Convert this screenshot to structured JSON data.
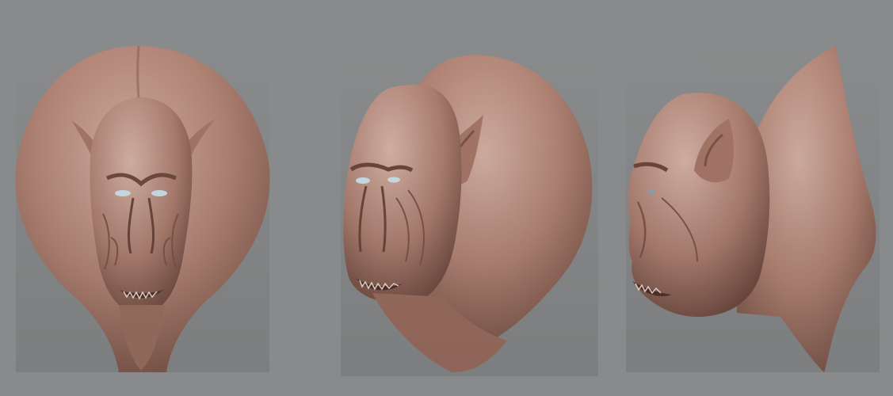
{
  "scene": {
    "background_color": "#888a8b",
    "material_light": "#c7a397",
    "material_mid": "#a97b6d",
    "material_dark": "#6e4a40",
    "eye_color": "#c9dfe8",
    "views": [
      {
        "name": "front"
      },
      {
        "name": "three-quarter"
      },
      {
        "name": "side"
      }
    ]
  }
}
